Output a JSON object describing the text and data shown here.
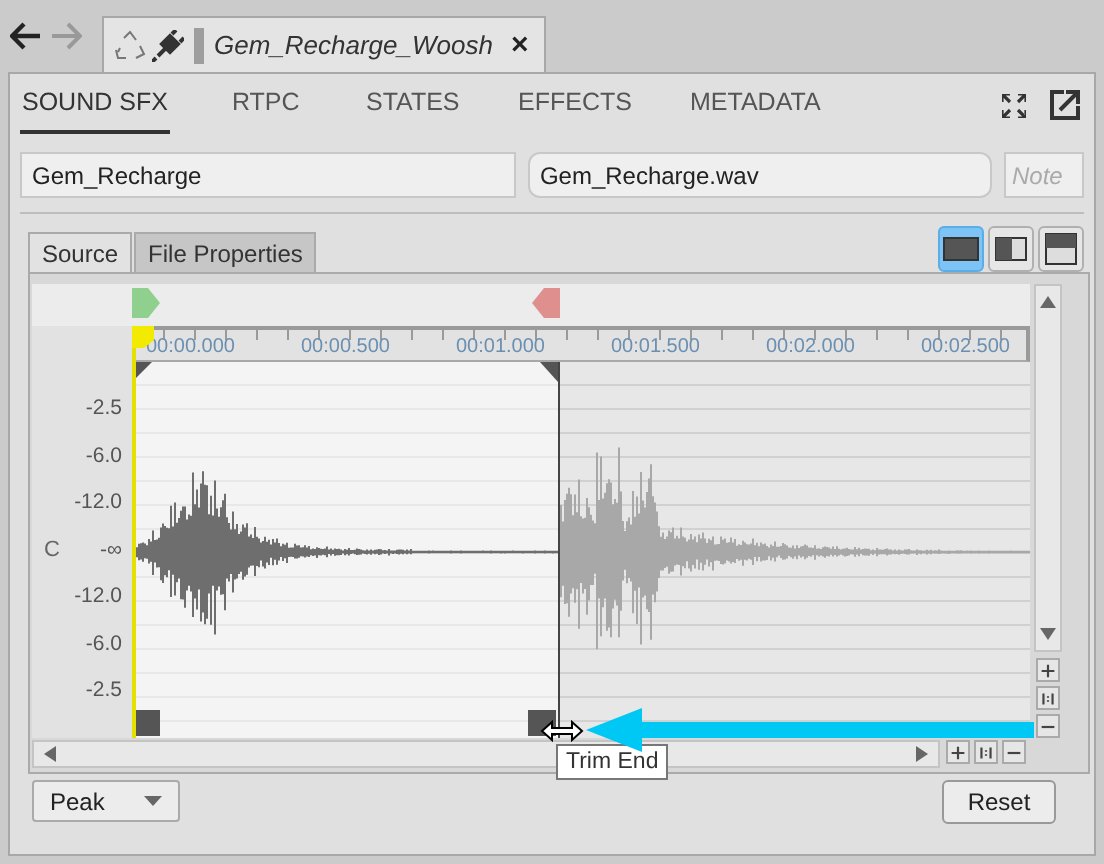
{
  "document_tab": {
    "title": "Gem_Recharge_Woosh",
    "close_symbol": "×"
  },
  "tabs": [
    {
      "label": "SOUND SFX",
      "selected": true
    },
    {
      "label": "RTPC",
      "selected": false
    },
    {
      "label": "STATES",
      "selected": false
    },
    {
      "label": "EFFECTS",
      "selected": false
    },
    {
      "label": "METADATA",
      "selected": false
    }
  ],
  "fields": {
    "name": {
      "value": "Gem_Recharge"
    },
    "source_file": {
      "value": "Gem_Recharge.wav"
    },
    "notes": {
      "placeholder": "Note"
    }
  },
  "source_tabs": [
    {
      "label": "Source",
      "selected": true
    },
    {
      "label": "File Properties",
      "selected": false
    }
  ],
  "view_modes": [
    {
      "kind": "single",
      "selected": true
    },
    {
      "kind": "side_by_side",
      "selected": false
    },
    {
      "kind": "stacked",
      "selected": false
    }
  ],
  "timeline": {
    "labels": [
      "00:00.000",
      "00:00.500",
      "00:01.000",
      "00:01.500",
      "00:02.000",
      "00:02.500"
    ]
  },
  "channel": {
    "label": "C",
    "db_labels": [
      "-2.5",
      "-6.0",
      "-12.0",
      "-∞",
      "-12.0",
      "-6.0",
      "-2.5"
    ]
  },
  "tooltip": "Trim End",
  "meter_mode": {
    "value": "Peak"
  },
  "reset_button": "Reset"
}
